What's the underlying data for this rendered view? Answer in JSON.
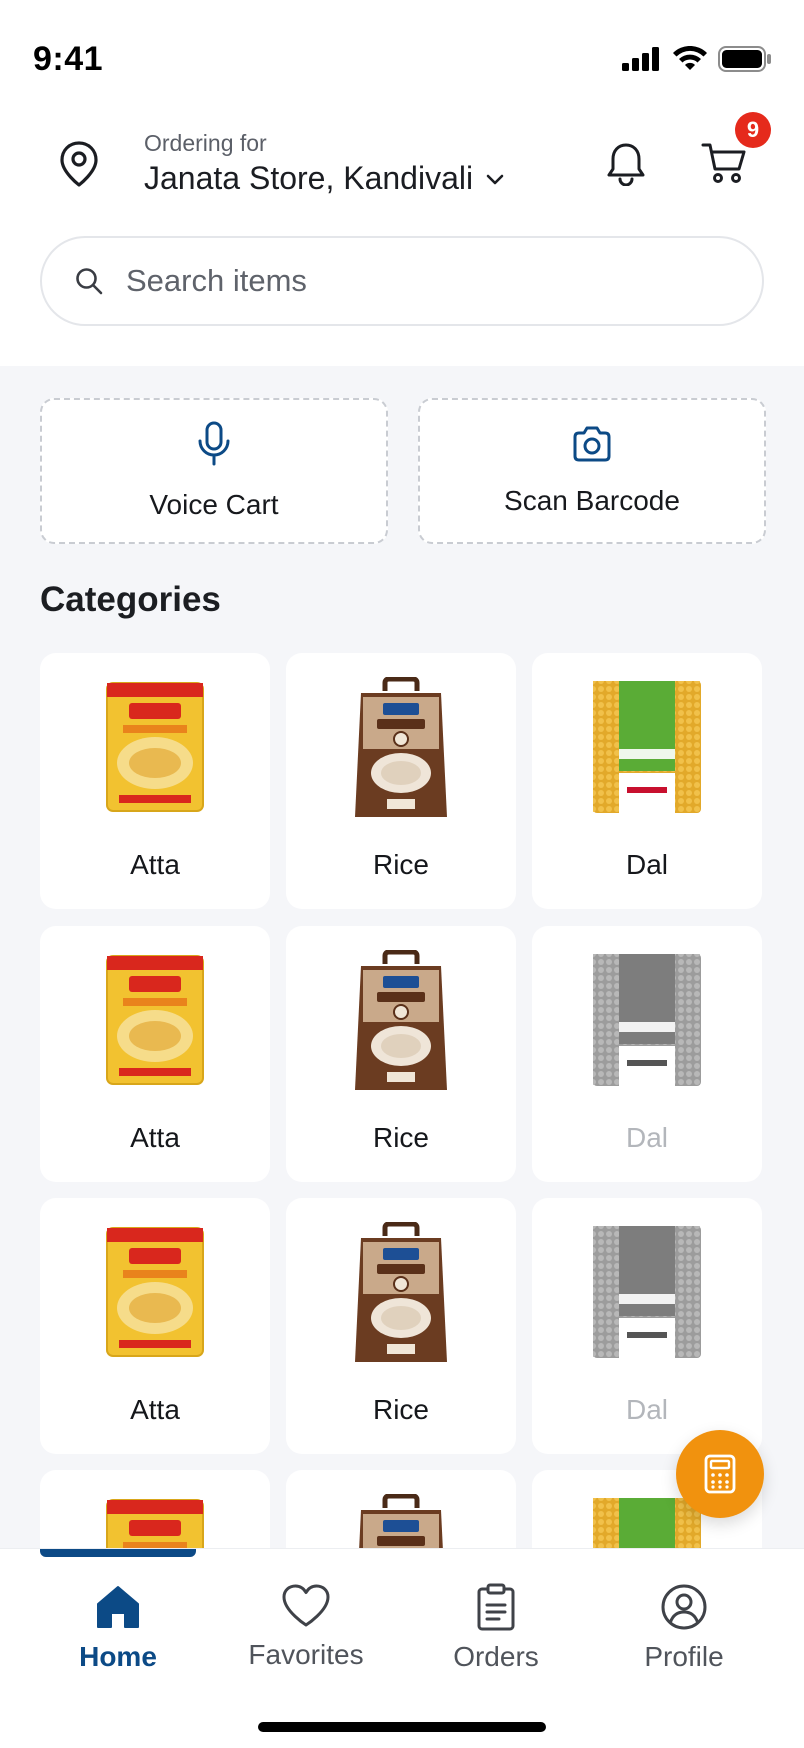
{
  "status_bar": {
    "time": "9:41"
  },
  "header": {
    "ordering_label": "Ordering for",
    "store_name": "Janata Store, Kandivali",
    "cart_count": "9"
  },
  "search": {
    "placeholder": "Search items"
  },
  "quick_actions": {
    "voice_cart": "Voice Cart",
    "scan_barcode": "Scan Barcode"
  },
  "categories_title": "Categories",
  "categories": [
    {
      "label": "Atta",
      "image": "atta-pack-icon",
      "disabled": false
    },
    {
      "label": "Rice",
      "image": "rice-bag-icon",
      "disabled": false
    },
    {
      "label": "Dal",
      "image": "dal-pack-icon",
      "disabled": false
    },
    {
      "label": "Atta",
      "image": "atta-pack-icon",
      "disabled": false
    },
    {
      "label": "Rice",
      "image": "rice-bag-icon",
      "disabled": false
    },
    {
      "label": "Dal",
      "image": "dal-pack-icon",
      "disabled": true
    },
    {
      "label": "Atta",
      "image": "atta-pack-icon",
      "disabled": false
    },
    {
      "label": "Rice",
      "image": "rice-bag-icon",
      "disabled": false
    },
    {
      "label": "Dal",
      "image": "dal-pack-icon",
      "disabled": true
    }
  ],
  "nav": {
    "home": "Home",
    "favorites": "Favorites",
    "orders": "Orders",
    "profile": "Profile",
    "active": "Home"
  },
  "colors": {
    "brand": "#0c4a86",
    "badge": "#e52a1c",
    "fab": "#f1920e",
    "background": "#f5f6f9"
  }
}
